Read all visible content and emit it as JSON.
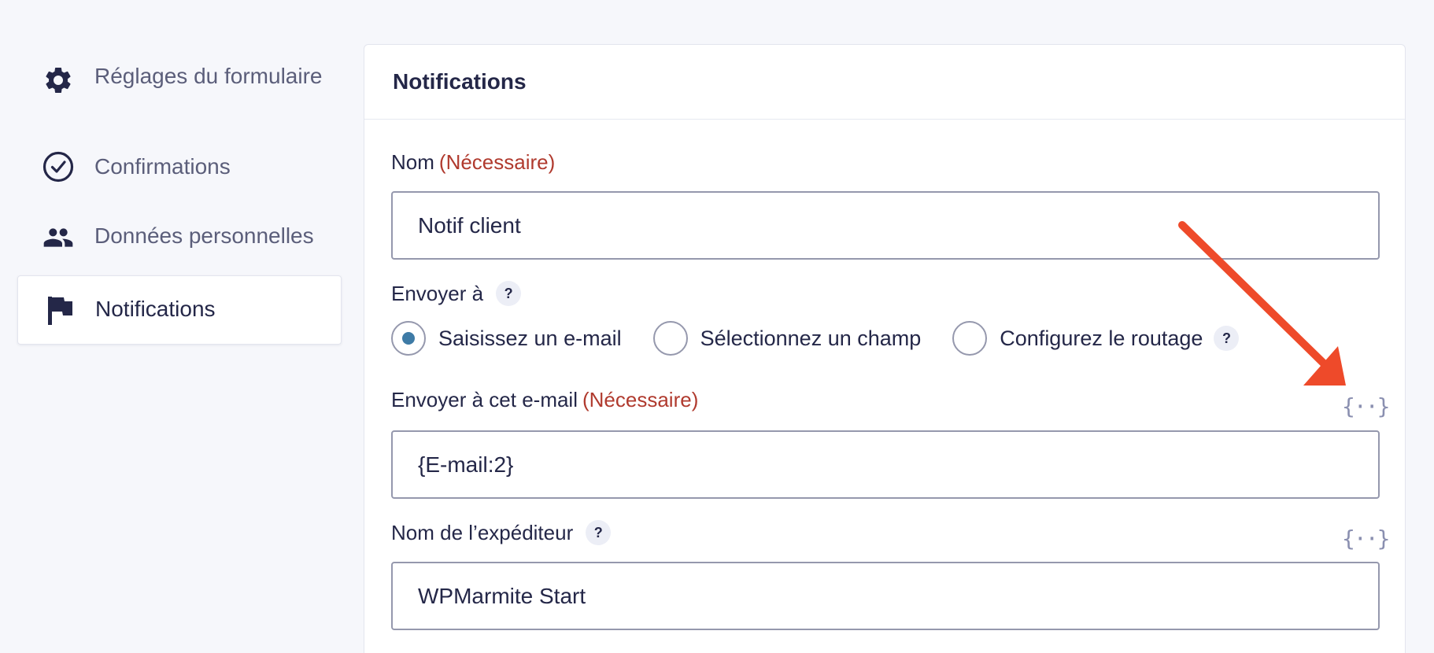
{
  "sidebar": {
    "items": [
      {
        "label": "Réglages du formulaire",
        "icon": "gear-icon"
      },
      {
        "label": "Confirmations",
        "icon": "check-circle-icon"
      },
      {
        "label": "Données personnelles",
        "icon": "users-icon"
      },
      {
        "label": "Notifications",
        "icon": "flag-icon",
        "active": true
      }
    ]
  },
  "panel": {
    "title": "Notifications",
    "name_field": {
      "label": "Nom",
      "required": "(Nécessaire)",
      "value": "Notif client"
    },
    "send_to": {
      "label": "Envoyer à",
      "help": "?",
      "options": [
        {
          "label": "Saisissez un e-mail",
          "checked": true
        },
        {
          "label": "Sélectionnez un champ",
          "checked": false
        },
        {
          "label": "Configurez le routage",
          "checked": false
        }
      ],
      "routing_help": "?"
    },
    "email_field": {
      "label": "Envoyer à cet e-mail",
      "required": "(Nécessaire)",
      "value": "{E-mail:2}",
      "merge_tag": "{··}"
    },
    "sender_field": {
      "label": "Nom de l’expéditeur",
      "help": "?",
      "value": "WPMarmite Start",
      "merge_tag": "{··}"
    }
  },
  "colors": {
    "accent": "#3e7ba6",
    "required": "#b03a2e",
    "arrow": "#ee4a2a"
  }
}
